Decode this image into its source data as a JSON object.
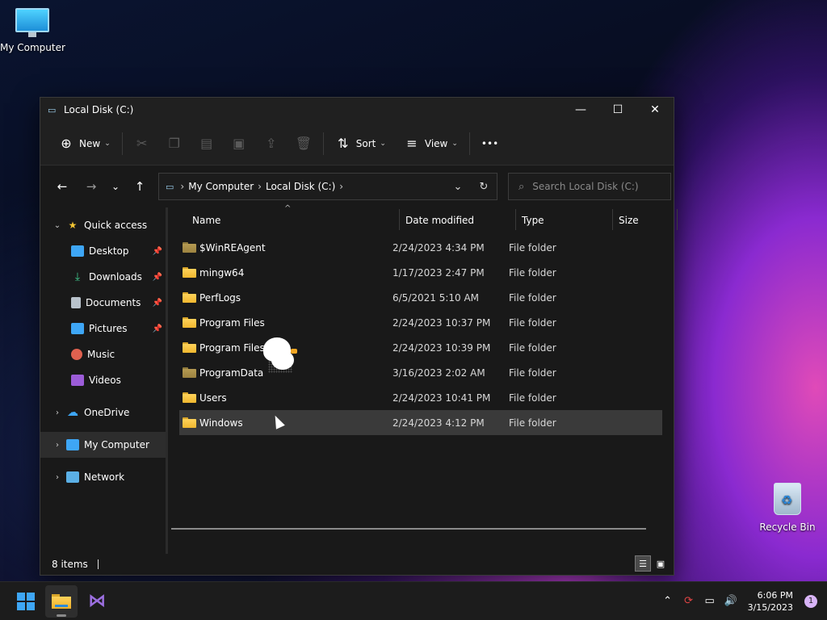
{
  "desktop": {
    "icons": [
      {
        "label": "My Computer"
      },
      {
        "label": "Recycle Bin"
      }
    ]
  },
  "window": {
    "title": "Local Disk (C:)",
    "controls": {
      "minimize": "—",
      "maximize": "☐",
      "close": "✕"
    }
  },
  "toolbar": {
    "new_label": "New",
    "sort_label": "Sort",
    "view_label": "View",
    "more": "•••"
  },
  "address": {
    "crumbs": [
      "My Computer",
      "Local Disk (C:)"
    ],
    "search_placeholder": "Search Local Disk (C:)"
  },
  "sidebar": {
    "quick_access": "Quick access",
    "pinned": [
      {
        "label": "Desktop",
        "icon": "desktop-icon",
        "color": "#3ea6f5"
      },
      {
        "label": "Downloads",
        "icon": "download-icon",
        "color": "#3fc58a"
      },
      {
        "label": "Documents",
        "icon": "document-icon",
        "color": "#b9c3cc"
      },
      {
        "label": "Pictures",
        "icon": "picture-icon",
        "color": "#3ea6f5"
      },
      {
        "label": "Music",
        "icon": "music-icon",
        "color": "#e0614f"
      },
      {
        "label": "Videos",
        "icon": "video-icon",
        "color": "#9c5cd8"
      }
    ],
    "onedrive": "OneDrive",
    "my_computer": "My Computer",
    "network": "Network"
  },
  "columns": {
    "name": "Name",
    "date": "Date modified",
    "type": "Type",
    "size": "Size"
  },
  "files": [
    {
      "name": "$WinREAgent",
      "date": "2/24/2023 4:34 PM",
      "type": "File folder",
      "dimmed": true
    },
    {
      "name": "mingw64",
      "date": "1/17/2023 2:47 PM",
      "type": "File folder",
      "dimmed": false
    },
    {
      "name": "PerfLogs",
      "date": "6/5/2021 5:10 AM",
      "type": "File folder",
      "dimmed": false
    },
    {
      "name": "Program Files",
      "date": "2/24/2023 10:37 PM",
      "type": "File folder",
      "dimmed": false
    },
    {
      "name": "Program Files",
      "date": "2/24/2023 10:39 PM",
      "type": "File folder",
      "dimmed": false
    },
    {
      "name": "ProgramData",
      "date": "3/16/2023 2:02 AM",
      "type": "File folder",
      "dimmed": true
    },
    {
      "name": "Users",
      "date": "2/24/2023 10:41 PM",
      "type": "File folder",
      "dimmed": false
    },
    {
      "name": "Windows",
      "date": "2/24/2023 4:12 PM",
      "type": "File folder",
      "dimmed": false,
      "selected": true
    }
  ],
  "status": {
    "items_text": "8 items"
  },
  "taskbar": {
    "clock_time": "6:06 PM",
    "clock_date": "3/15/2023",
    "notification_count": "1"
  }
}
